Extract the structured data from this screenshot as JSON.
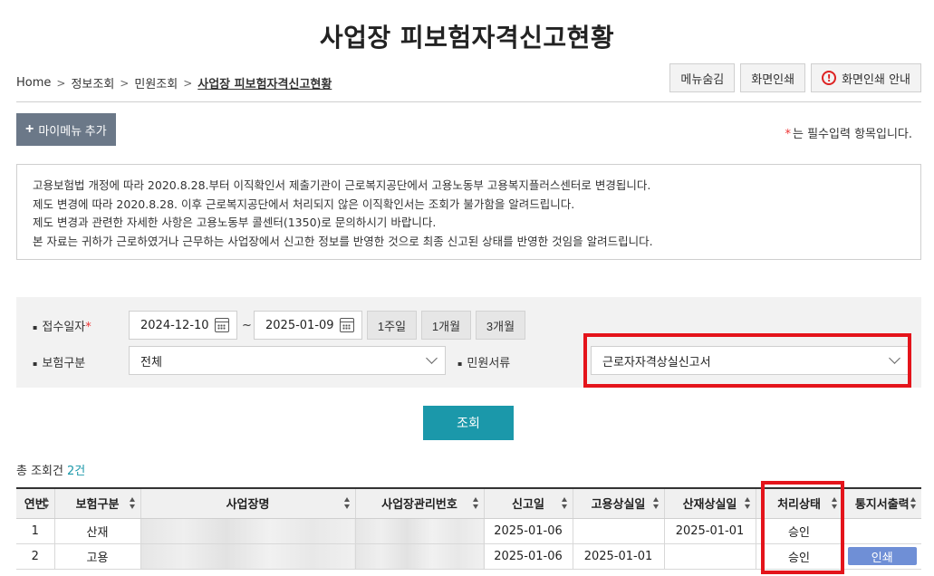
{
  "page": {
    "title": "사업장 피보험자격신고현황"
  },
  "breadcrumb": {
    "items": [
      "Home",
      "정보조회",
      "민원조회"
    ],
    "current": "사업장 피보험자격신고현황"
  },
  "top_buttons": {
    "hide_menu": "메뉴숨김",
    "print_screen": "화면인쇄",
    "print_guide": "화면인쇄 안내",
    "alert_glyph": "!"
  },
  "my_menu": {
    "plus_glyph": "+",
    "label": "마이메뉴 추가"
  },
  "required_note": {
    "star": "*",
    "text": "는 필수입력 항목입니다."
  },
  "notice": {
    "lines": [
      "고용보험법 개정에 따라 2020.8.28.부터 이직확인서 제출기관이 근로복지공단에서 고용노동부 고용복지플러스센터로 변경됩니다.",
      "제도 변경에 따라 2020.8.28. 이후 근로복지공단에서 처리되지 않은 이직확인서는 조회가 불가함을 알려드립니다.",
      "제도 변경과 관련한 자세한 사항은 고용노동부 콜센터(1350)로 문의하시기 바랍니다.",
      "본 자료는 귀하가 근로하였거나 근무하는 사업장에서 신고한 정보를 반영한 것으로 최종 신고된 상태를 반영한 것임을 알려드립니다."
    ]
  },
  "search": {
    "bullet": "▪",
    "receipt_date_label": "접수일자",
    "required_star": "*",
    "date_from": "2024-12-10",
    "date_to": "2025-01-09",
    "tilde": "~",
    "period_buttons": [
      "1주일",
      "1개월",
      "3개월"
    ],
    "insurance_type_label": "보험구분",
    "insurance_type_value": "전체",
    "document_label": "민원서류",
    "document_value": "근로자자격상실신고서",
    "search_button": "조회"
  },
  "results": {
    "total_label": "총 조회건",
    "total_count": "2건",
    "columns": [
      "연번",
      "보험구분",
      "사업장명",
      "사업장관리번호",
      "신고일",
      "고용상실일",
      "산재상실일",
      "처리상태",
      "통지서출력"
    ],
    "rows": [
      {
        "no": "1",
        "insurance": "산재",
        "report_date": "2025-01-06",
        "emp_loss": "",
        "ind_loss": "2025-01-01",
        "status": "승인",
        "print": ""
      },
      {
        "no": "2",
        "insurance": "고용",
        "report_date": "2025-01-06",
        "emp_loss": "2025-01-01",
        "ind_loss": "",
        "status": "승인",
        "print": "인쇄"
      }
    ]
  },
  "colors": {
    "accent": "#1b98aa",
    "highlight": "#e4141b",
    "menu_button": "#6b7888",
    "print_button": "#6f8fd6"
  }
}
